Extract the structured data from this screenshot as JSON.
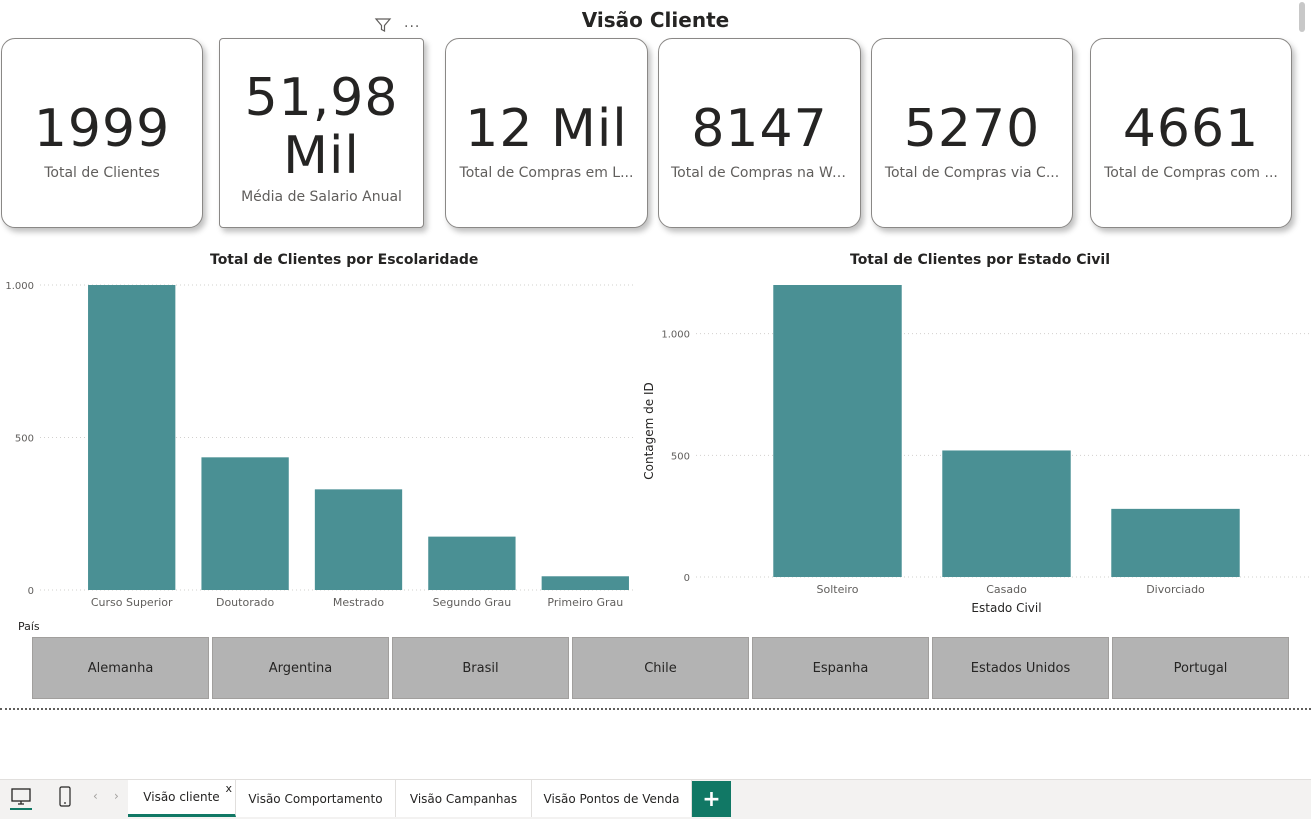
{
  "page": {
    "title": "Visão Cliente"
  },
  "cards": [
    {
      "value": "1999",
      "label": "Total de Clientes"
    },
    {
      "value_line1": "51,98",
      "value_line2": "Mil",
      "label": "Média de Salario Anual"
    },
    {
      "value": "12 Mil",
      "label": "Total de Compras em L..."
    },
    {
      "value": "8147",
      "label": "Total de Compras na Web"
    },
    {
      "value": "5270",
      "label": "Total de Compras via C..."
    },
    {
      "value": "4661",
      "label": "Total de Compras com ..."
    }
  ],
  "chart_data": [
    {
      "type": "bar",
      "title": "Total de Clientes por Escolaridade",
      "categories": [
        "Curso Superior",
        "Doutorado",
        "Mestrado",
        "Segundo Grau",
        "Primeiro Grau"
      ],
      "values": [
        1000,
        435,
        330,
        175,
        45
      ],
      "ylim": [
        0,
        1000
      ],
      "yticks": [
        "0",
        "500",
        "1.000"
      ],
      "ytick_values": [
        0,
        500,
        1000
      ],
      "xlabel": "",
      "ylabel": "",
      "grid": true,
      "color": "#4a9094"
    },
    {
      "type": "bar",
      "title": "Total de Clientes por Estado Civil",
      "categories": [
        "Solteiro",
        "Casado",
        "Divorciado"
      ],
      "values": [
        1200,
        520,
        280
      ],
      "ylim": [
        0,
        1200
      ],
      "yticks": [
        "0",
        "500",
        "1.000"
      ],
      "ytick_values": [
        0,
        500,
        1000
      ],
      "xlabel": "Estado Civil",
      "ylabel": "Contagem de ID",
      "grid": true,
      "color": "#4a9094"
    }
  ],
  "slicer": {
    "label": "País",
    "items": [
      "Alemanha",
      "Argentina",
      "Brasil",
      "Chile",
      "Espanha",
      "Estados Unidos",
      "Portugal"
    ]
  },
  "tabs": {
    "items": [
      "Visão cliente",
      "Visão Comportamento",
      "Visão Campanhas",
      "Visão Pontos de Venda"
    ],
    "close_label": "x",
    "add_label": "+",
    "prev_label": "‹",
    "next_label": "›"
  },
  "colors": {
    "bar": "#4a9094",
    "accent": "#117865",
    "slicer_bg": "#b3b3b3"
  },
  "icons": {
    "filter": "filter-icon",
    "more": "more-options-icon",
    "desktop": "desktop-view-icon",
    "mobile": "mobile-view-icon"
  }
}
